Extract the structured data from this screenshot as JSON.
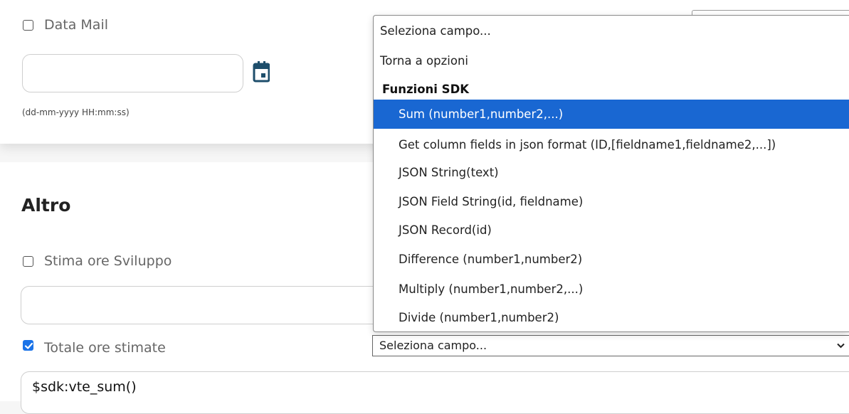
{
  "top_section": {
    "data_mail": {
      "label": "Data Mail",
      "checked": false,
      "value": "",
      "hint": "(dd-mm-yyyy HH:mm:ss)"
    }
  },
  "altro_section": {
    "title": "Altro",
    "stima": {
      "label": "Stima ore Sviluppo",
      "checked": false,
      "value": ""
    },
    "totale": {
      "label": "Totale ore stimate",
      "checked": true,
      "value": "$sdk:vte_sum()"
    }
  },
  "dropdown": {
    "placeholder": "Seleziona campo...",
    "back_label": "Torna a opzioni",
    "group_label": "Funzioni SDK",
    "options": [
      "Sum (number1,number2,...)",
      "Get column fields in json format (ID,[fieldname1,fieldname2,...])",
      "JSON String(text)",
      "JSON Field String(id, fieldname)",
      "JSON Record(id)",
      "Difference (number1,number2)",
      "Multiply (number1,number2,...)",
      "Divide (number1,number2)"
    ],
    "selected_index": 0
  },
  "field_select": {
    "value": "Seleziona campo..."
  },
  "colors": {
    "highlight": "#1967d2",
    "checkbox_checked": "#1a73e8",
    "calendar_icon": "#1e4e6b"
  },
  "icons": [
    "calendar-icon",
    "chevron-down-icon",
    "checkmark-icon"
  ]
}
